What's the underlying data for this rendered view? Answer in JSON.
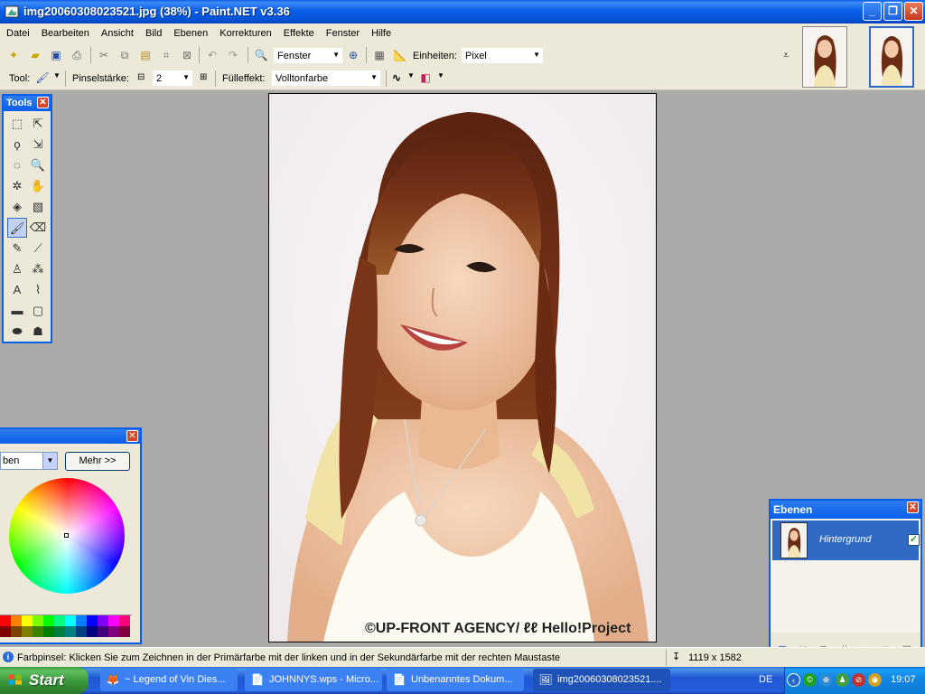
{
  "window": {
    "title": "img20060308023521.jpg (38%) - Paint.NET v3.36",
    "minimize": "_",
    "restore": "❐",
    "close": "✕"
  },
  "menu": [
    "Datei",
    "Bearbeiten",
    "Ansicht",
    "Bild",
    "Ebenen",
    "Korrekturen",
    "Effekte",
    "Fenster",
    "Hilfe"
  ],
  "toolbar": {
    "zoom_value": "Fenster",
    "units_label": "Einheiten:",
    "units_value": "Pixel",
    "tool_label": "Tool:",
    "brush_width_label": "Pinselstärke:",
    "brush_width_value": "2",
    "fill_label": "Fülleffekt:",
    "fill_value": "Volltonfarbe"
  },
  "tools_window": {
    "title": "Tools",
    "close": "✕"
  },
  "tools": [
    {
      "name": "rectangle-select-icon",
      "glyph": "⬚"
    },
    {
      "name": "move-selection-icon",
      "glyph": "⇱"
    },
    {
      "name": "lasso-select-icon",
      "glyph": "ϙ"
    },
    {
      "name": "move-selected-icon",
      "glyph": "⇲"
    },
    {
      "name": "ellipse-select-icon",
      "glyph": "◌"
    },
    {
      "name": "zoom-icon",
      "glyph": "🔍"
    },
    {
      "name": "magic-wand-icon",
      "glyph": "✲"
    },
    {
      "name": "pan-hand-icon",
      "glyph": "✋"
    },
    {
      "name": "paint-bucket-icon",
      "glyph": "◈"
    },
    {
      "name": "gradient-icon",
      "glyph": "▧"
    },
    {
      "name": "paintbrush-icon",
      "glyph": "🖌"
    },
    {
      "name": "eraser-icon",
      "glyph": "⌫"
    },
    {
      "name": "pencil-icon",
      "glyph": "✎"
    },
    {
      "name": "color-picker-icon",
      "glyph": "⟋"
    },
    {
      "name": "clone-stamp-icon",
      "glyph": "♙"
    },
    {
      "name": "recolor-icon",
      "glyph": "⁂"
    },
    {
      "name": "text-icon",
      "glyph": "A"
    },
    {
      "name": "line-curve-icon",
      "glyph": "⌇"
    },
    {
      "name": "rectangle-icon",
      "glyph": "▬"
    },
    {
      "name": "rounded-rectangle-icon",
      "glyph": "▢"
    },
    {
      "name": "ellipse-icon",
      "glyph": "⬬"
    },
    {
      "name": "freeform-shape-icon",
      "glyph": "☗"
    }
  ],
  "colors_window": {
    "mode_value": "ben",
    "more_button": "Mehr >>",
    "close": "✕",
    "palette": [
      "#ff0000",
      "#ff8000",
      "#ffff00",
      "#80ff00",
      "#00ff00",
      "#00ff80",
      "#00ffff",
      "#0080ff",
      "#0000ff",
      "#8000ff",
      "#ff00ff",
      "#ff0080",
      "#800000",
      "#804000",
      "#808000",
      "#408000",
      "#008000",
      "#008040",
      "#008080",
      "#004080",
      "#000080",
      "#400080",
      "#800080",
      "#800040"
    ]
  },
  "canvas": {
    "watermark": "©UP-FRONT AGENCY/ ℓℓ Hello!Project"
  },
  "layers_window": {
    "title": "Ebenen",
    "close": "✕",
    "layers": [
      {
        "name": "Hintergrund",
        "visible": true
      }
    ]
  },
  "status": {
    "text": "Farbpinsel: Klicken Sie zum Zeichnen in der Primärfarbe mit der linken und in der Sekundärfarbe mit der rechten Maustaste",
    "image_size": "1119 x 1582"
  },
  "taskbar": {
    "start_label": "Start",
    "tasks": [
      {
        "label": "~ Legend of Vin Dies...",
        "icon": "firefox-icon",
        "active": false
      },
      {
        "label": "JOHNNYS.wps - Micro...",
        "icon": "works-document-icon",
        "active": false
      },
      {
        "label": "Unbenanntes Dokum...",
        "icon": "document-icon",
        "active": false
      },
      {
        "label": "img20060308023521....",
        "icon": "paintnet-icon",
        "active": true
      }
    ],
    "language": "DE",
    "clock": "19:07"
  }
}
